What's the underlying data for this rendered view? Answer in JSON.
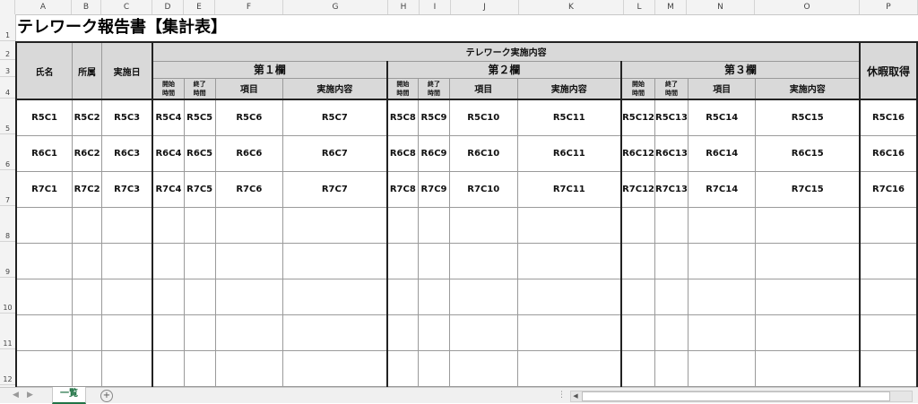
{
  "columns": [
    "A",
    "B",
    "C",
    "D",
    "E",
    "F",
    "G",
    "H",
    "I",
    "J",
    "K",
    "L",
    "M",
    "N",
    "O",
    "P"
  ],
  "rows": [
    "1",
    "2",
    "3",
    "4",
    "5",
    "6",
    "7",
    "8",
    "9",
    "10",
    "11",
    "12"
  ],
  "title": "テレワーク報告書【集計表】",
  "header": {
    "name": "氏名",
    "dept": "所属",
    "date": "実施日",
    "group": "テレワーク実施内容",
    "section1": "第１欄",
    "section2": "第２欄",
    "section3": "第３欄",
    "leave": "休暇取得",
    "start_line1": "開始",
    "start_line2": "時間",
    "end_line1": "終了",
    "end_line2": "時間",
    "item": "項目",
    "content": "実施内容"
  },
  "data_rows": [
    [
      "R5C1",
      "R5C2",
      "R5C3",
      "R5C4",
      "R5C5",
      "R5C6",
      "R5C7",
      "R5C8",
      "R5C9",
      "R5C10",
      "R5C11",
      "R5C12",
      "R5C13",
      "R5C14",
      "R5C15",
      "R5C16"
    ],
    [
      "R6C1",
      "R6C2",
      "R6C3",
      "R6C4",
      "R6C5",
      "R6C6",
      "R6C7",
      "R6C8",
      "R6C9",
      "R6C10",
      "R6C11",
      "R6C12",
      "R6C13",
      "R6C14",
      "R6C15",
      "R6C16"
    ],
    [
      "R7C1",
      "R7C2",
      "R7C3",
      "R7C4",
      "R7C5",
      "R7C6",
      "R7C7",
      "R7C8",
      "R7C9",
      "R7C10",
      "R7C11",
      "R7C12",
      "R7C13",
      "R7C14",
      "R7C15",
      "R7C16"
    ]
  ],
  "sheet_tab": "一覧",
  "add_sheet_symbol": "+",
  "nav_prev": "◀",
  "nav_next": "▶",
  "scroll_dots": "⋮",
  "colors": {
    "tab_accent": "#217346",
    "header_fill": "#d9d9d9"
  }
}
